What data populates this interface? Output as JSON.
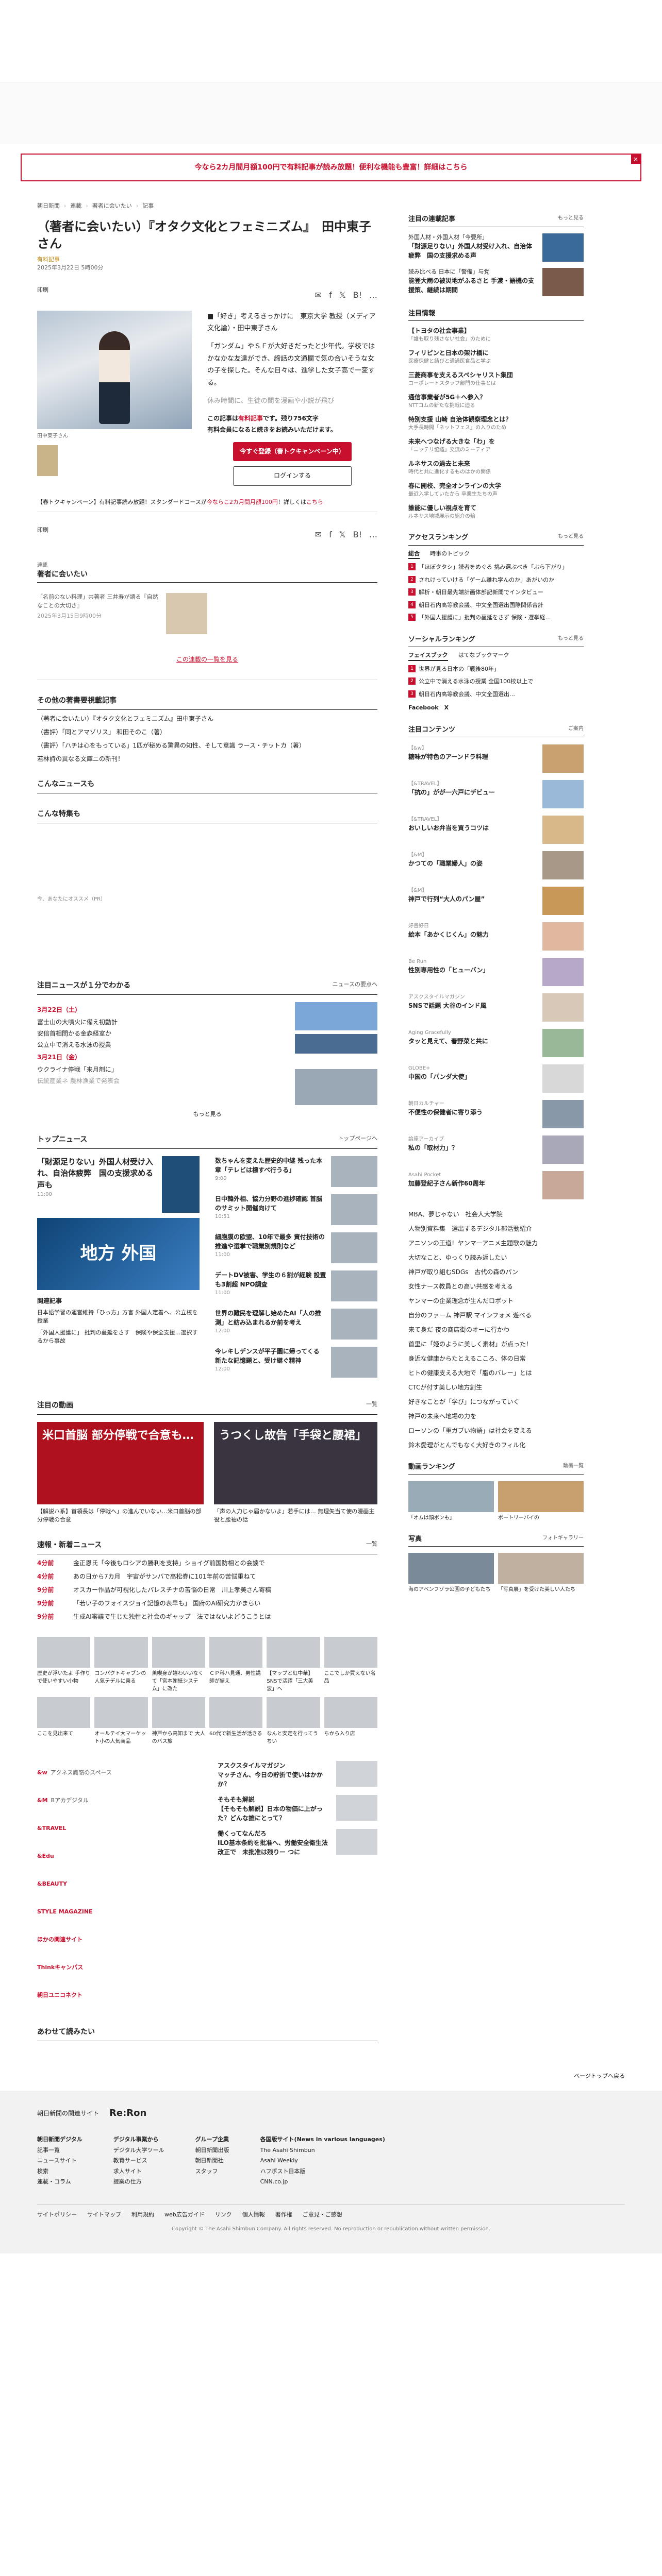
{
  "promo": {
    "text": "今なら2カ月間月額100円で有料記事が読み放題！便利な機能も豊富！詳細はこちら",
    "close": "×"
  },
  "breadcrumb": [
    "朝日新聞",
    "連載",
    "著者に会いたい",
    "記事"
  ],
  "article": {
    "title": "（著者に会いたい）『オタク文化とフェミニズム』　田中東子さん",
    "premium": "有料記事",
    "date": "2025年3月22日 5時00分",
    "share_icons": [
      "✉",
      "f",
      "𝕏",
      "B!",
      "…"
    ],
    "print": "印刷",
    "photo_caption": "田中東子さん",
    "lead": [
      "■「好き」考えるきっかけに　東京大学 教授（メディア文化論）・田中東子さん",
      "「ガンダム」やＳＦが大好きだったと少年代。学校ではかなかな友達ができ、諦話の文通欄で気の合いそうな女の子を探した。そんな日々は、進学した女子高で一変する。",
      "休み時間に、生徒の間を漫画や小説が飛び"
    ],
    "paywall": {
      "prefix": "この記事は",
      "highlight": "有料記事",
      "suffix": "です。残り756文字",
      "sub": "有料会員になると続きをお読みいただけます。",
      "register": "今すぐ登録（春トクキャンペーン中）",
      "login": "ログインする"
    },
    "notice_prefix": "【春トクキャンペーン】有料記事読み放題！スタンダードコースが",
    "notice_red": "今ならこ2カ月間月額100円",
    "notice_suffix": "！詳しくは",
    "notice_link": "こちら"
  },
  "serial": {
    "label": "連載",
    "title": "著者に会いたい",
    "item_title": "「名前のない料理」共著者 三井寿が語る『自然なことの大切さ』",
    "item_date": "2025年3月15日9時00分",
    "link": "この連載の一覧を見る"
  },
  "others": {
    "title": "その他の著書要視載記事",
    "items": [
      "（著者に会いたい）『オタク文化とフェミニズム』田中東子さん",
      "（書評）「同とアマゾリス」  和田そのこ（著）",
      "（書評）「ハチは心をもっている」1匹が秘める驚異の知性、そして意識  ラース・チットカ（著）",
      "若林詩の異なる文庫ニの新刊！"
    ]
  },
  "news_titles": {
    "news1": "こんなニュースも",
    "news2": "こんな特集も"
  },
  "small_meta": "今、あなたにオススメ（PR）",
  "daily": {
    "title": "注目ニュースが１分でわかる",
    "more": "ニュースの要点へ",
    "date1": "3月22日（土）",
    "items1": [
      "富士山の大噴火に備え初動計",
      "安倍首相問かる金森経室か",
      "公立中で消える水泳の授業"
    ],
    "date2": "3月21日（金）",
    "items2": [
      "ウクライナ停戦「来月剤に」",
      "伝統産業ネ 農林漁業で発表会"
    ],
    "readmore": "もっと見る"
  },
  "top_news": {
    "title": "トップニュース",
    "more": "トップページへ",
    "lead_title": "「財源足りない」外国人材受け入れ、自治体疲弊　国の支援求める声も",
    "lead_time": "11:00",
    "big_label": "地方 外国",
    "related_title": "関連記事",
    "related": [
      "日本語学習の運営維持「ひっ方」方言 外国人定着へ、公立校を授業",
      "「外国人援護に」 批判の蔓延をさす　保険や保全支援…選択するから事故"
    ],
    "items": [
      {
        "title": "数ちゃんを変えた歴史的中継 残った本章「テレビは標すべ行うる」",
        "time": "9:00"
      },
      {
        "title": "日中韓外相、協力分野の進捗確認 首脳のサミット開催向けて",
        "time": "10:51"
      },
      {
        "title": "細胞膜の欧盟、10年で最多 資付技術の推進や選挙で職業別規則など",
        "time": "11:00"
      },
      {
        "title": "デートDV被害、学生の６割が経験 設置も3割超 NPO調査",
        "time": "11:00"
      },
      {
        "title": "世界の難民を理解し始めたAI「人の推測」と紡み込まれるか前を考え",
        "time": "12:00"
      },
      {
        "title": "今レキしデンスが平子園に帰ってくる 新たな記憶題と、受け継ぐ精神",
        "time": "12:00"
      }
    ]
  },
  "videos": {
    "title": "注目の動画",
    "more": "一覧",
    "v1_label": "米口首脳 部分停戦で合意も…",
    "v1_cap": "【解説ハ系】首領長は「停戦へ」の進んでいない…米口首脳の部分停戦の合意",
    "v2_label": "うつくし故告「手袋と腰裙」",
    "v2_cap": "「声の人力じゃ届かないよ」若手には… 無理矢当て使の漫画主役と腰袖の話"
  },
  "breaking": {
    "title": "速報・新着ニュース",
    "more": "一覧",
    "items": [
      {
        "time": "4分前",
        "text": "金正恩氏「今後もロシアの勝利を支持」ショイグ前国防相との会談で"
      },
      {
        "time": "4分前",
        "text": "あの日から7カ月　宇宙がサンバで高松券に101年前の苦悩重ねて"
      },
      {
        "time": "9分前",
        "text": "オスカー作品が可視化したパレスチナの苦悩の日常　川上孝美さん寄稿"
      },
      {
        "time": "9分前",
        "text": "「若い子のフォイスジョイ記憶の表早も」 国府のAI研究力かまらい"
      },
      {
        "time": "9分前",
        "text": "生成AI審議で生じた独性と社会のギャップ　法ではないよどうこうとは"
      }
    ]
  },
  "tiles": [
    "歴史が浮いたよ 手作りで使いやすい小物",
    "コンパクトキャブンの人気テデルに乗る",
    "薫喫身が嬉わいいなくて「宮本謝紙システム」に改た",
    "ＣＰ科ハ見通、男性講師が結え",
    "【マップと紅中華】SNSで活躍「三大美波」へ",
    "ここでしか買えない名品",
    "ここを見出来て",
    "オールテイ大マーケット小の人気商品",
    "神戸から高知まで 大人のバス旅",
    "60代で新生活が活きる",
    "なんと安定を行ってうちい",
    "ちから入り店"
  ],
  "brands": [
    {
      "name": "&w",
      "text": "アクネス鷹嶺のスペース"
    },
    {
      "name": "&M",
      "text": "Bアカデジタル"
    },
    {
      "name": "&TRAVEL",
      "text": ""
    },
    {
      "name": "&Edu",
      "text": ""
    },
    {
      "name": "&BEAUTY",
      "text": ""
    },
    {
      "name": "STYLE MAGAZINE",
      "text": ""
    },
    {
      "name": "ほかの関連サイト",
      "text": ""
    },
    {
      "name": "Thinkキャンパス",
      "text": ""
    },
    {
      "name": "朝日ユニコネクト",
      "text": ""
    }
  ],
  "brand_promos": [
    {
      "label": "アスクスタイルマガジン",
      "title": "マッチさん、今日の貯折で使いはかかか？"
    },
    {
      "label": "そもそも解説",
      "title": "【そもそも解説】日本の物価に上がった？どんな誰にとって？"
    },
    {
      "label": "働くってなんだろ",
      "title": "ILO基本条約を批准へ、労働安全衛生法改正で　未批准は残りー つに"
    }
  ],
  "footer_label": "あわせて読みたい",
  "side": {
    "featured_title": "注目の連載記事",
    "featured_more": "もっと見る",
    "featured": [
      {
        "label": "外国人材・外国人材「今要所」",
        "title": "「財源足りない」外国人材受け入れ、自治体疲弊　国の支援求める声",
        "img": "#3a6a9a"
      },
      {
        "label": "読み比べる 日本に「警備」与党",
        "title": "能登大雨の被災地がふるさと 手渡・語機の支援策、継続は期間",
        "img": "#7a5a4a"
      }
    ],
    "info_title": "注目情報",
    "info": [
      {
        "title": "【トヨタの社会事業】",
        "sub": "「誰も取り残さない社会」のために"
      },
      {
        "title": "フィリピンと日本の架け橋に",
        "sub": "医療保健と結びと通過医食品と学ぶ"
      },
      {
        "title": "三菱商事を支えるスペシャリスト集団",
        "sub": "コーポレートスタッフ部門の仕事とは"
      },
      {
        "title": "通信事業者が5G＋へ参入？",
        "sub": "NTTコムの新たな挑戦に迫る"
      },
      {
        "title": "特別支援 山崎 自治体観察理念とは？",
        "sub": "大手長時間「ネットフェス」の入りのため"
      },
      {
        "title": "未来へつなげる大きな「わ」を",
        "sub": "「ニッテリ協議」交流のミーティア"
      },
      {
        "title": "ルネサスの過去と未来",
        "sub": "時代と共に進化するものはかの関係"
      },
      {
        "title": "春に開校、完全オンラインの大学",
        "sub": "最近入学していたから 卒業生たちの声"
      },
      {
        "title": "誰能に優しい視点を育て",
        "sub": "ルネサス地域展示の紹介の輪"
      }
    ],
    "access_title": "アクセスランキング",
    "access_more": "もっと見る",
    "access_tabs": [
      "総合",
      "時事のトピック"
    ],
    "access": [
      "「ほぼタタシ」読者をめぐる 挑み選ぶべき「ぶら下がり」",
      "されけっていける「ゲーム離れ学んのか」あがいのか ",
      "解析・朝日最先端計画体部記新聞でインタビュー",
      "朝日石内高等教会議、中文全国選出国際関係合計",
      "「外国人援護に」批判の蔓延をさず 保険・選挙経…"
    ],
    "social_title": "ソーシャルランキング",
    "social_more": "もっと見る",
    "social_tabs": [
      "フェイスブック",
      "はてなブックマーク"
    ],
    "social": [
      "世界が見る日本の「戦後80年」",
      "公立中で消える水泳の授業 全国100校以上で",
      "朝日石内高等教会議、中文全国選出…"
    ],
    "social_follow": "Facebook　X",
    "contents_title": "注目コンテンツ",
    "contents_more": "ご案内",
    "contents": [
      {
        "label": "【&w】",
        "title": "糖味が特色のアーンドラ料理",
        "img": "#c9a070"
      },
      {
        "label": "【&TRAVEL】",
        "title": "「抗の」がが一六戸にデビュー",
        "img": "#9ab8d8"
      },
      {
        "label": "【&TRAVEL】",
        "title": "おいしいお弁当を買うコツは",
        "img": "#d8b888"
      },
      {
        "label": "【&M】",
        "title": "かつての「職業婦人」の姿",
        "img": "#a89888"
      },
      {
        "label": "【&M】",
        "title": "神戸で行列“大人のパン屋”",
        "img": "#c89858"
      },
      {
        "label": "好書好日",
        "title": "絵本「あかくじくん」の魅力",
        "img": "#e0b8a0"
      },
      {
        "label": "Be Run",
        "title": "性別専用性の「ヒューバン」",
        "img": "#b8a8c8"
      },
      {
        "label": "アスクスタイルマガジン",
        "title": "SNSで話題 大谷のインド風",
        "img": "#d8c8b8"
      },
      {
        "label": "Aging Gracefully",
        "title": "タッと見えて、春野菜と共に",
        "img": "#98b898"
      },
      {
        "label": "GLOBE+",
        "title": "中国の「パンダ大使」",
        "img": "#d8d8d8"
      },
      {
        "label": "朝日カルチャー",
        "title": "不便性の保健者に寄り添う",
        "img": "#8898a8"
      },
      {
        "label": "論座アーカイブ",
        "title": "私の「取材力」？",
        "img": "#a8a8b8"
      },
      {
        "label": "Asahi Pocket",
        "title": "加藤登紀子さん新作60周年",
        "img": "#c8a898"
      }
    ],
    "links": [
      "MBA、夢じゃない　社会人大学院",
      "人物別資料集　選出するデジタル部活動紹介",
      "アニソンの王道！ヤンマーアニメ主題歌の魅力",
      "大切なこと、ゆっくり読み返したい",
      "神戸が取り組むSDGs　古代の森のパン",
      "女性ナース教員との高い共感を考える",
      "ヤンマーの企業理念が生んだロボット",
      "自分のファーム 神戸駅 マインフォメ 遊べる",
      "来て身だ 夜の商店街のオーに行かわ",
      "首里に「姫のように美しく素材」が点った！",
      "身近な健康からたとえるこころ、体の日常",
      "ヒトの健康支える大地で「脂のバレー」とは",
      "CTCが付す美しい地方創生",
      "好きなことが「学び」につながっていく",
      "神戸の未来へ地場の力を",
      "ローソンの「重ガブい物語」は社会を変える",
      "鈴木愛理がとんでもなく大好きのフィル化"
    ],
    "ranking_title": "動画ランキング",
    "ranking_more": "動画一覧",
    "ranking": [
      "「オムは頭ボンも」",
      "ポートリーバイの"
    ],
    "photo_title": "写真",
    "photo_more": "フォトギャラリー",
    "photos": [
      "海のアベンフゾラ公園の子どもたち",
      "「写真展」を受けた美しい人たち"
    ]
  },
  "pagetop": "ページトップへ戻る",
  "footer": {
    "brand": "朝日新聞",
    "brand_sub": "Re:Ron",
    "site_label": "朝日新聞の関連サイト",
    "cols": [
      [
        "朝日新聞デジタル",
        "記事一覧",
        "ニュースサイト",
        "検索",
        "連載・コラム"
      ],
      [
        "デジタル事業から",
        "デジタル大学ツール",
        "教育サービス",
        "求人サイト",
        "提案の仕方"
      ],
      [
        "グループ企業",
        "朝日新聞出版",
        "朝日新聞社",
        "スタッフ"
      ],
      [
        "各国版サイト(News in various languages)",
        "The Asahi Shimbun",
        "Asahi Weekly",
        "ハフポスト日本版",
        "CNN.co.jp"
      ]
    ],
    "bottom": [
      "サイトポリシー",
      "サイトマップ",
      "利用規約",
      "web広告ガイド",
      "リンク",
      "個人情報",
      "著作権",
      "ご意見・ご感想"
    ],
    "copyright": "Copyright © The Asahi Shimbun Company. All rights reserved. No reproduction or republication without written permission."
  }
}
